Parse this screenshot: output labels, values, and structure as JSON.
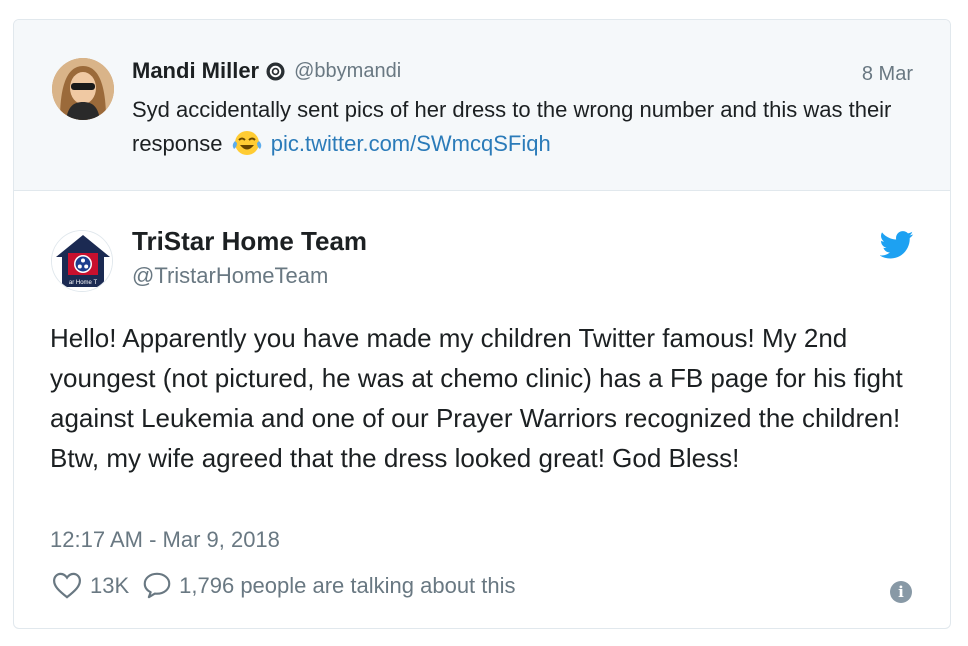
{
  "quoted_tweet": {
    "author_name": "Mandi Miller",
    "author_handle": "@bbymandi",
    "date": "8 Mar",
    "text_before_emoji": "Syd accidentally sent pics of her dress to the wrong number and this was their response",
    "emoji": "face-with-tears-of-joy",
    "link": "pic.twitter.com/SWmcqSFiqh"
  },
  "tweet": {
    "author_name": "TriStar Home Team",
    "author_handle": "@TristarHomeTeam",
    "text": "Hello! Apparently you have made my children Twitter famous! My 2nd youngest (not pictured, he was at chemo clinic) has a FB page for his fight against Leukemia and one of our Prayer Warriors recognized the children! Btw, my wife agreed that the dress looked great! God Bless!",
    "timestamp": "12:17 AM - Mar 9, 2018",
    "avatar_caption": "ar Home T"
  },
  "actions": {
    "likes": "13K",
    "conversation": "1,796 people are talking about this",
    "info_glyph": "i"
  },
  "icons": {
    "verified": "verified-badge-icon",
    "twitter": "twitter-bird-icon",
    "like": "heart-icon",
    "reply": "speech-bubble-icon",
    "info": "info-icon"
  },
  "colors": {
    "link": "#2b7bb9",
    "twitter_blue": "#1da1f2",
    "muted": "#697882",
    "quoted_bg": "#f5f8fa",
    "border": "#e1e8ed"
  }
}
